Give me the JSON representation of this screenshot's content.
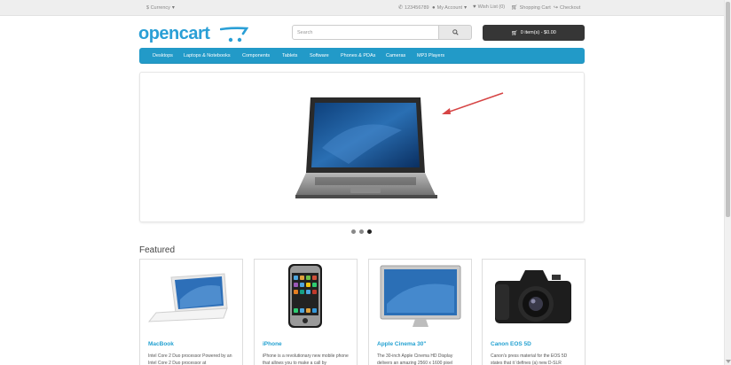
{
  "topbar": {
    "currency": "$ Currency",
    "phone": "123456789",
    "my_account": "My Account",
    "wishlist": "Wish List (0)",
    "shopping_cart": "Shopping Cart",
    "checkout": "Checkout"
  },
  "header": {
    "logo_text": "opencart",
    "search_placeholder": "Search",
    "cart_label": "0 item(s) - $0.00"
  },
  "menu": {
    "items": [
      "Desktops",
      "Laptops & Notebooks",
      "Components",
      "Tablets",
      "Software",
      "Phones & PDAs",
      "Cameras",
      "MP3 Players"
    ]
  },
  "slideshow": {
    "slide_count": 3,
    "active_slide": 3
  },
  "featured": {
    "title": "Featured",
    "products": [
      {
        "name": "MacBook",
        "desc": "Intel Core 2 Duo processor Powered by an Intel Core 2 Duo processor at"
      },
      {
        "name": "iPhone",
        "desc": "iPhone is a revolutionary new mobile phone that allows you to make a call by"
      },
      {
        "name": "Apple Cinema 30\"",
        "desc": "The 30-inch Apple Cinema HD Display delivers an amazing 2560 x 1600 pixel"
      },
      {
        "name": "Canon EOS 5D",
        "desc": "Canon's press material for the EOS 5D states that it 'defines (a) new D-SLR"
      }
    ]
  },
  "colors": {
    "brand_blue": "#229ac8",
    "cart_dark": "#363636",
    "link_blue": "#23a1d1"
  }
}
